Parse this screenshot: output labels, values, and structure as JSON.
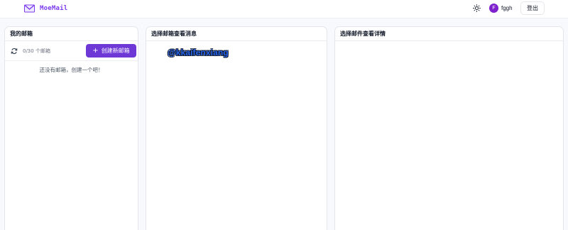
{
  "header": {
    "app_name": "MoeMail",
    "user": {
      "initial": "F",
      "name": "fggh"
    },
    "logout_label": "登出",
    "theme_icon": "sun-icon"
  },
  "mailboxes": {
    "title": "我的邮箱",
    "count_text": "0/30 个邮箱",
    "create_label": "创建新邮箱",
    "empty_text": "还没有邮箱，创建一个吧！"
  },
  "messages": {
    "title": "选择邮箱查看消息",
    "watermark": "@kkaifenxiang"
  },
  "detail": {
    "title": "选择邮件查看详情"
  },
  "colors": {
    "accent": "#6d38d6",
    "logo": "#7c3aed",
    "avatar": "#7e22ce",
    "watermark": "#2563eb"
  }
}
